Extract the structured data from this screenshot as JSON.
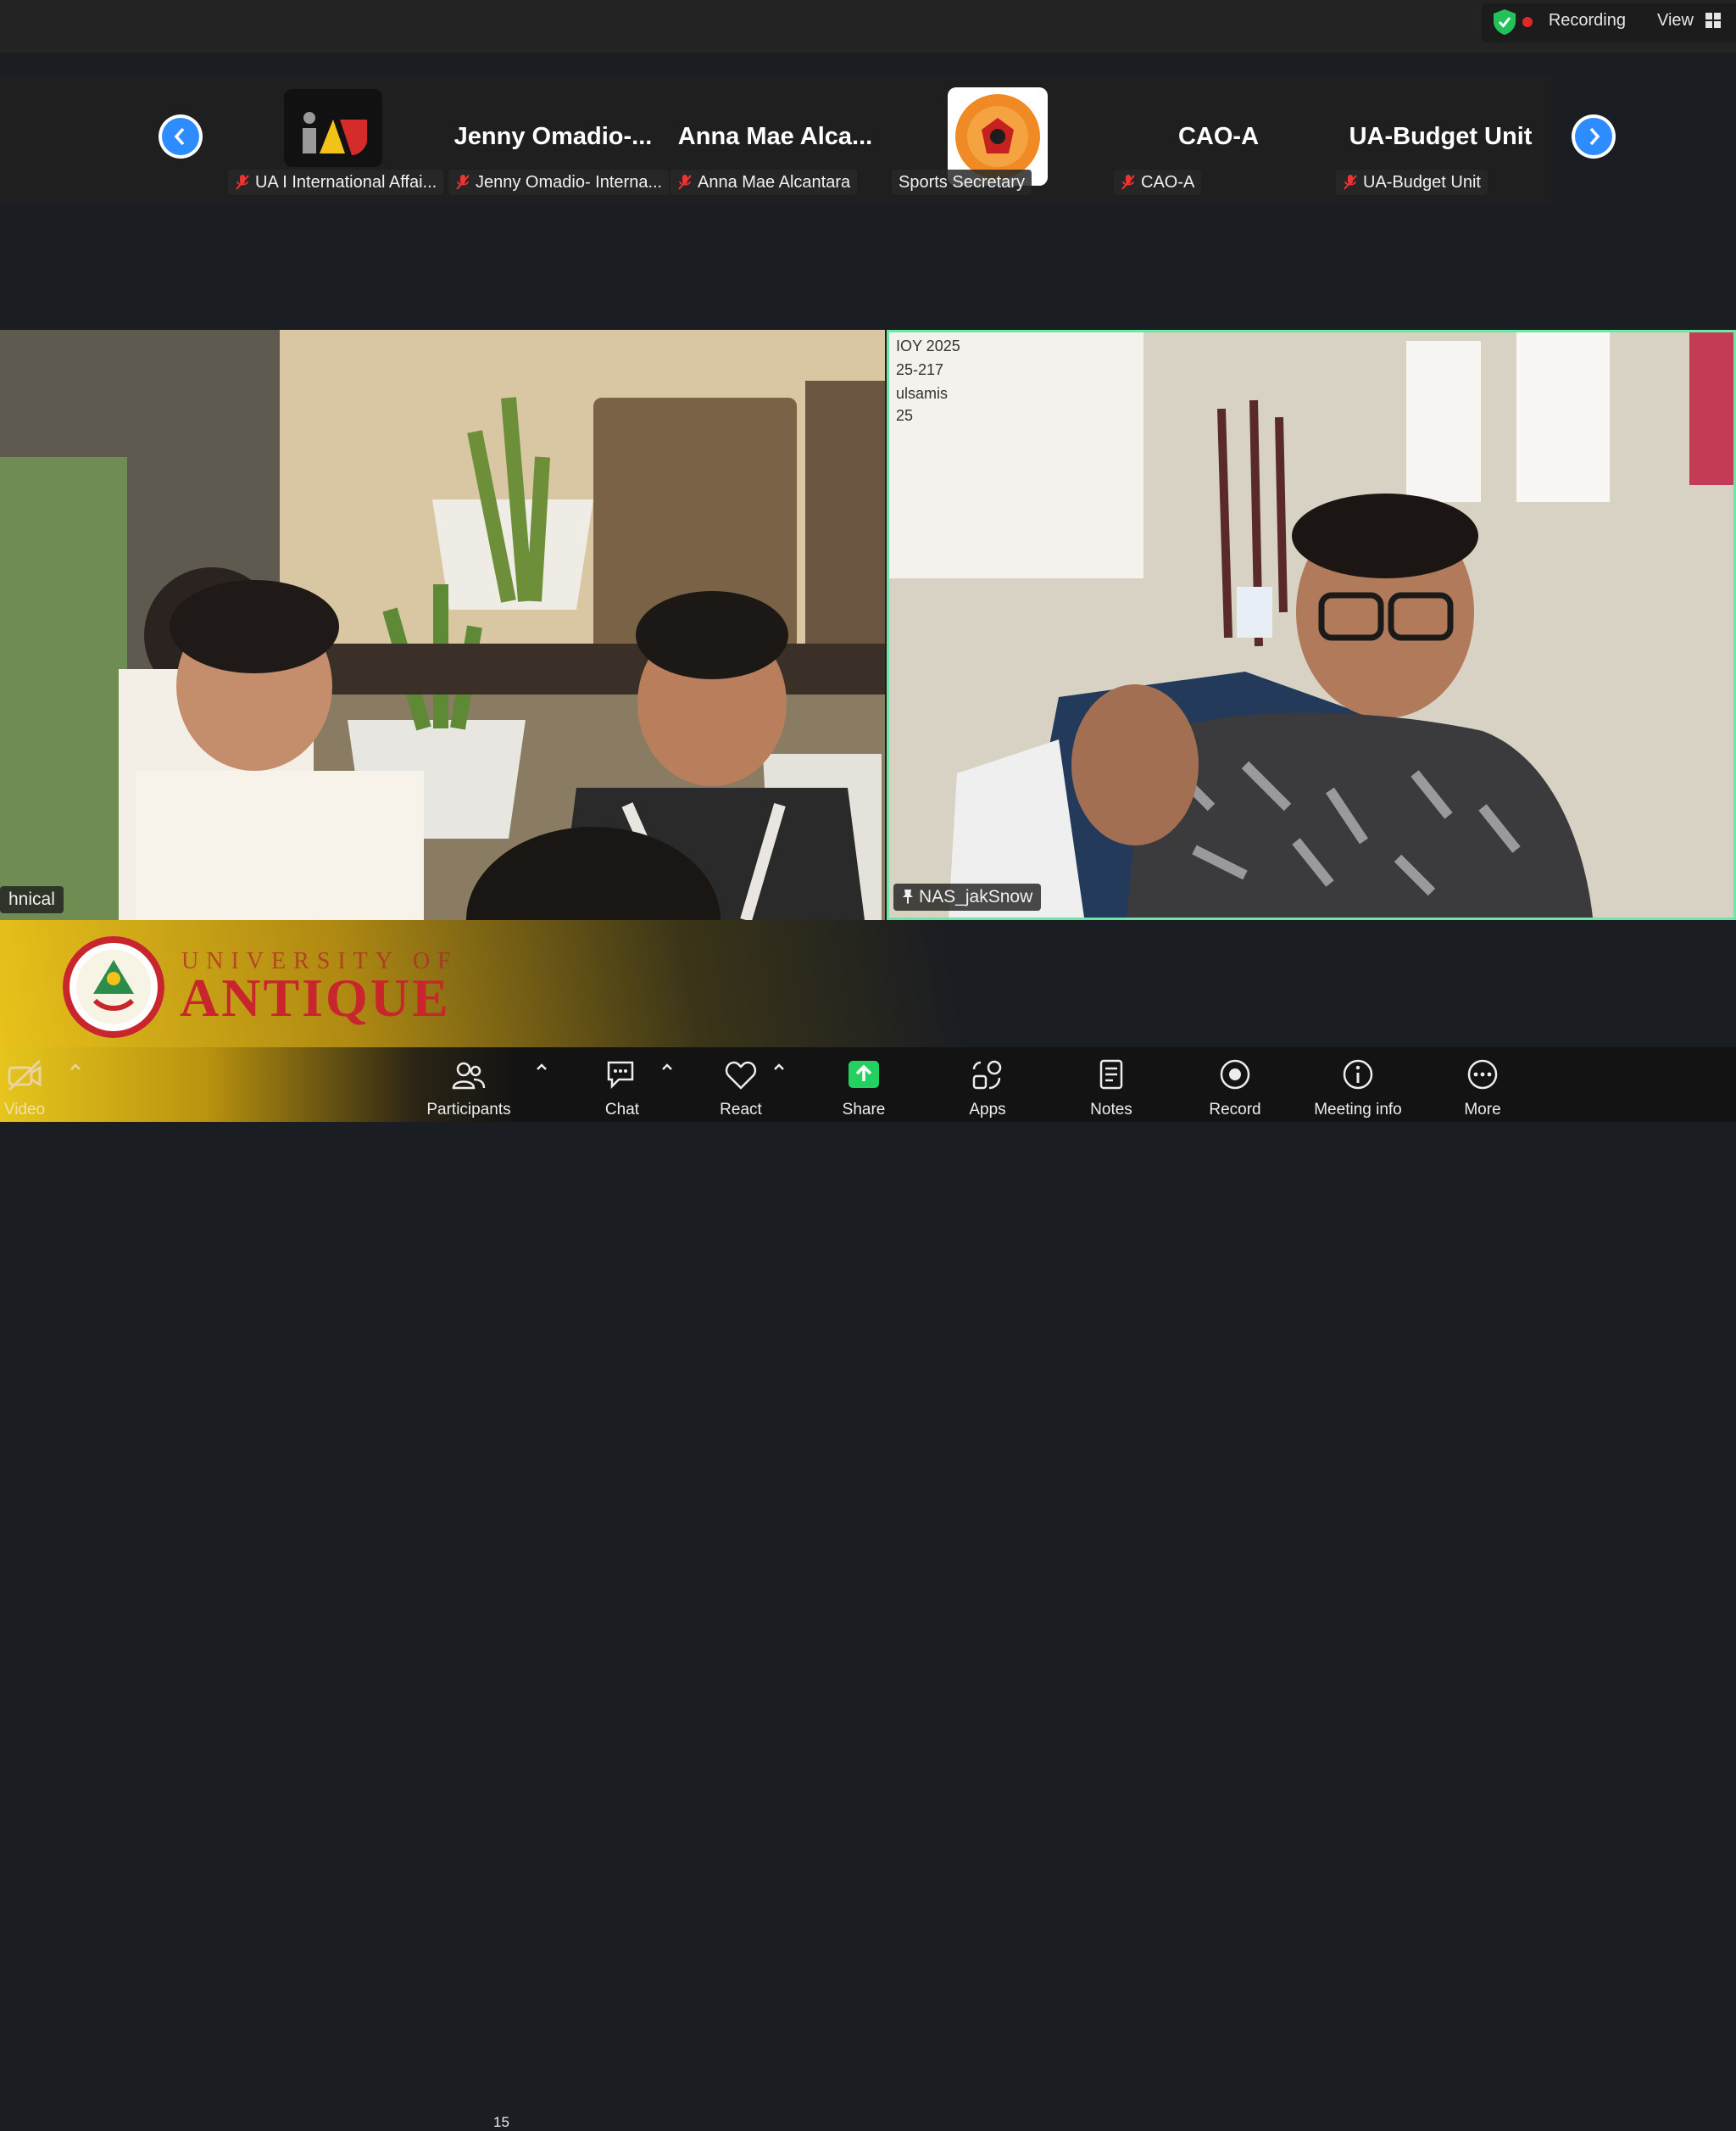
{
  "status_bar": {
    "recording_label": "Recording",
    "view_label": "View"
  },
  "participants_strip": [
    {
      "display": "",
      "label": "UA I International Affai...",
      "muted": true,
      "has_logo": "ua-logo"
    },
    {
      "display": "Jenny  Omadio-...",
      "label": "Jenny Omadio- Interna...",
      "muted": true
    },
    {
      "display": "Anna  Mae  Alca...",
      "label": "Anna Mae Alcantara",
      "muted": true
    },
    {
      "display": "",
      "label": "Sports Secretary",
      "muted": false,
      "has_logo": "sports-unit-logo"
    },
    {
      "display": "CAO-A",
      "label": "CAO-A",
      "muted": true
    },
    {
      "display": "UA-Budget Unit",
      "label": "UA-Budget Unit",
      "muted": true
    }
  ],
  "videos": {
    "left": {
      "label": "hnical"
    },
    "right": {
      "label": "NAS_jakSnow"
    }
  },
  "banner": {
    "university_small": "UNIVERSITY OF",
    "university_big": "ANTIQUE"
  },
  "toolbar": {
    "video": "Video",
    "participants": "Participants",
    "participants_count": "15",
    "chat": "Chat",
    "react": "React",
    "share": "Share",
    "apps": "Apps",
    "notes": "Notes",
    "record": "Record",
    "meeting_info": "Meeting info",
    "more": "More"
  },
  "colors": {
    "accent": "#2d8cff",
    "share_green": "#23d160",
    "active_speaker": "#6ee7a4",
    "recording_red": "#e02828"
  }
}
